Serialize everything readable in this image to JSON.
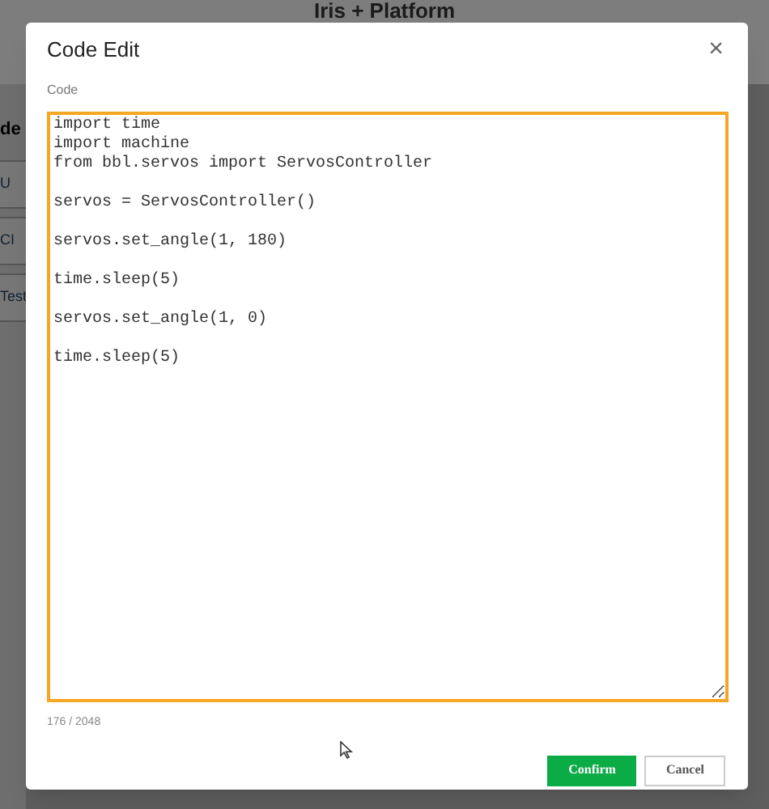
{
  "page": {
    "title": "Iris + Platform",
    "side_heading": "de",
    "side_items": [
      "U",
      "CI",
      "Test"
    ]
  },
  "dialog": {
    "title": "Code Edit",
    "close": "×",
    "field_label": "Code",
    "code": "import time\nimport machine\nfrom bbl.servos import ServosController\n\nservos = ServosController()\n\nservos.set_angle(1, 180)\n\ntime.sleep(5)\n\nservos.set_angle(1, 0)\n\ntime.sleep(5)",
    "counter": "176 / 2048",
    "buttons": [
      {
        "label": "Confirm",
        "kind": "primary"
      },
      {
        "label": "Cancel",
        "kind": "secondary"
      }
    ]
  }
}
